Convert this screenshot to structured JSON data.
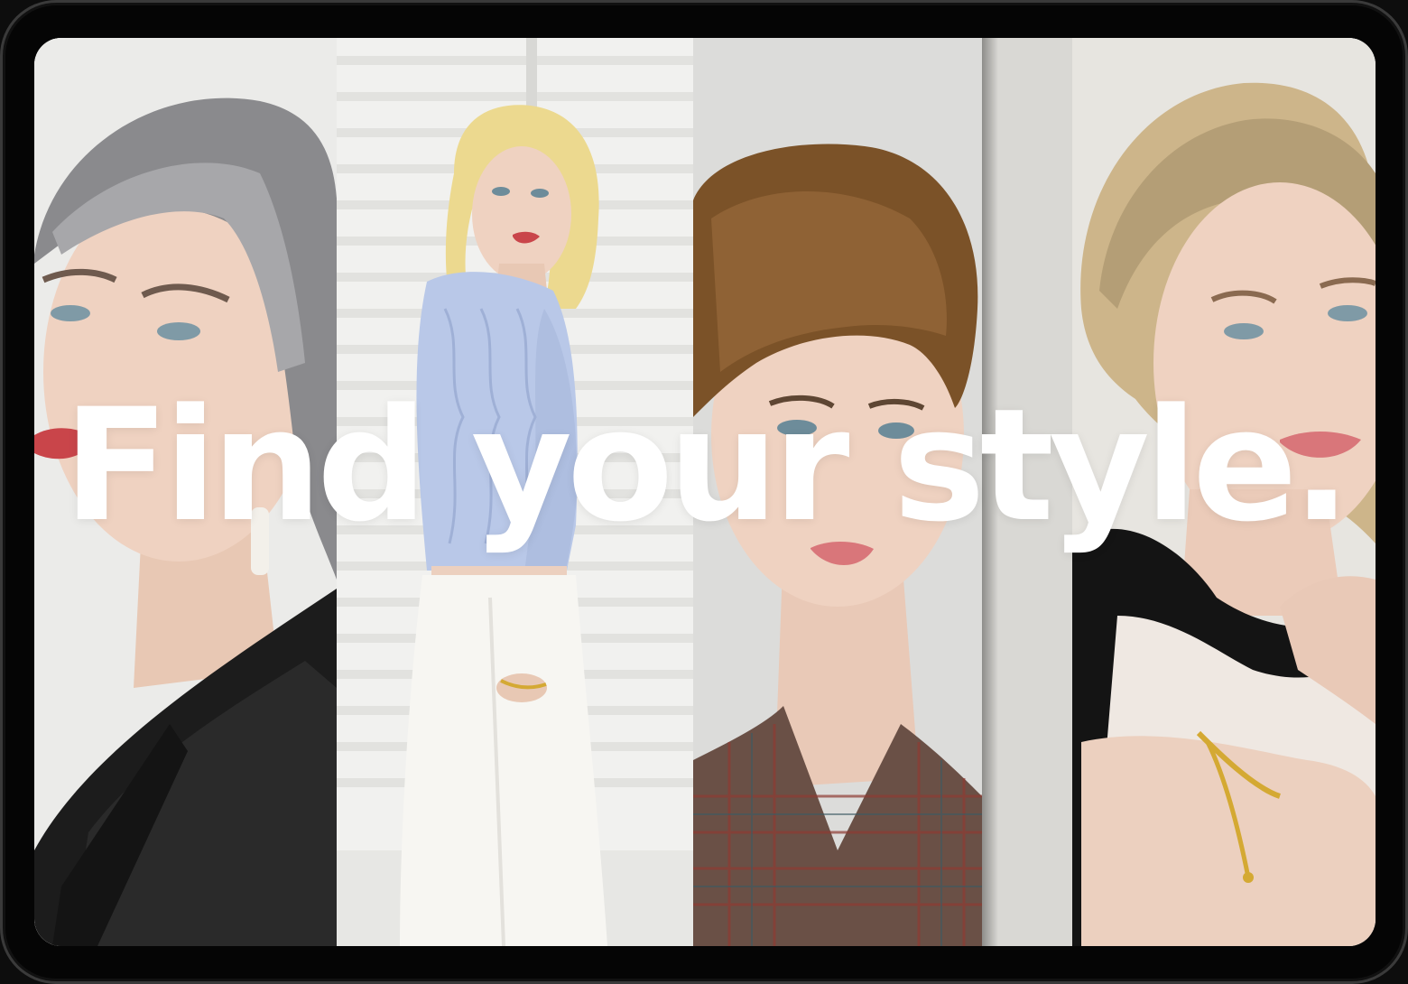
{
  "hero": {
    "headline": "Find your style."
  },
  "colors": {
    "bezel": "#050505",
    "headline": "#ffffff",
    "hair_gray": "#8a8a8d",
    "hair_blonde": "#ecd98f",
    "hair_brown": "#7b5228",
    "hair_ash_blonde": "#cdb58a"
  }
}
